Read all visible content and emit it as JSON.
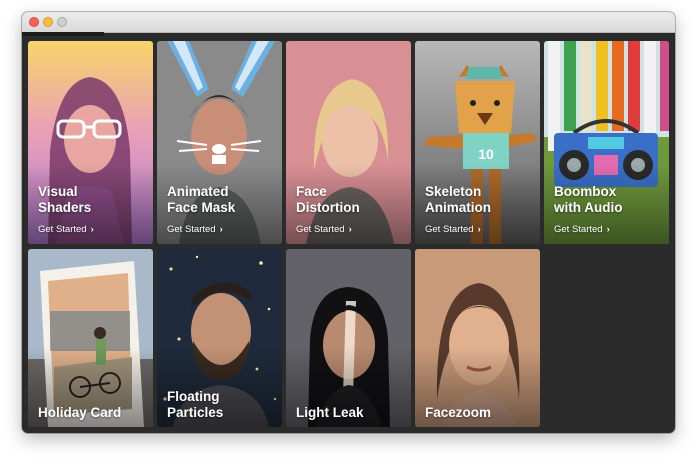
{
  "window": {
    "title": ""
  },
  "cards": [
    {
      "title_line1": "Visual",
      "title_line2": "Shaders",
      "cta": "Get Started",
      "cta_icon": "chevron-right-icon"
    },
    {
      "title_line1": "Animated",
      "title_line2": "Face Mask",
      "cta": "Get Started",
      "cta_icon": "chevron-right-icon"
    },
    {
      "title_line1": "Face",
      "title_line2": "Distortion",
      "cta": "Get Started",
      "cta_icon": "chevron-right-icon"
    },
    {
      "title_line1": "Skeleton",
      "title_line2": "Animation",
      "cta": "Get Started",
      "cta_icon": "chevron-right-icon"
    },
    {
      "title_line1": "Boombox",
      "title_line2": "with Audio",
      "cta": "Get Started",
      "cta_icon": "chevron-right-icon"
    },
    {
      "title_line1": "Holiday Card",
      "title_line2": ""
    },
    {
      "title_line1": "Floating",
      "title_line2": "Particles"
    },
    {
      "title_line1": "Light Leak",
      "title_line2": ""
    },
    {
      "title_line1": "Facezoom",
      "title_line2": ""
    }
  ],
  "bear_jersey_number": "10",
  "colors": {
    "window_bg": "#2b2b2b",
    "traffic_red": "#fc605c",
    "traffic_yellow": "#fdbc40",
    "card_text": "#ffffff"
  }
}
